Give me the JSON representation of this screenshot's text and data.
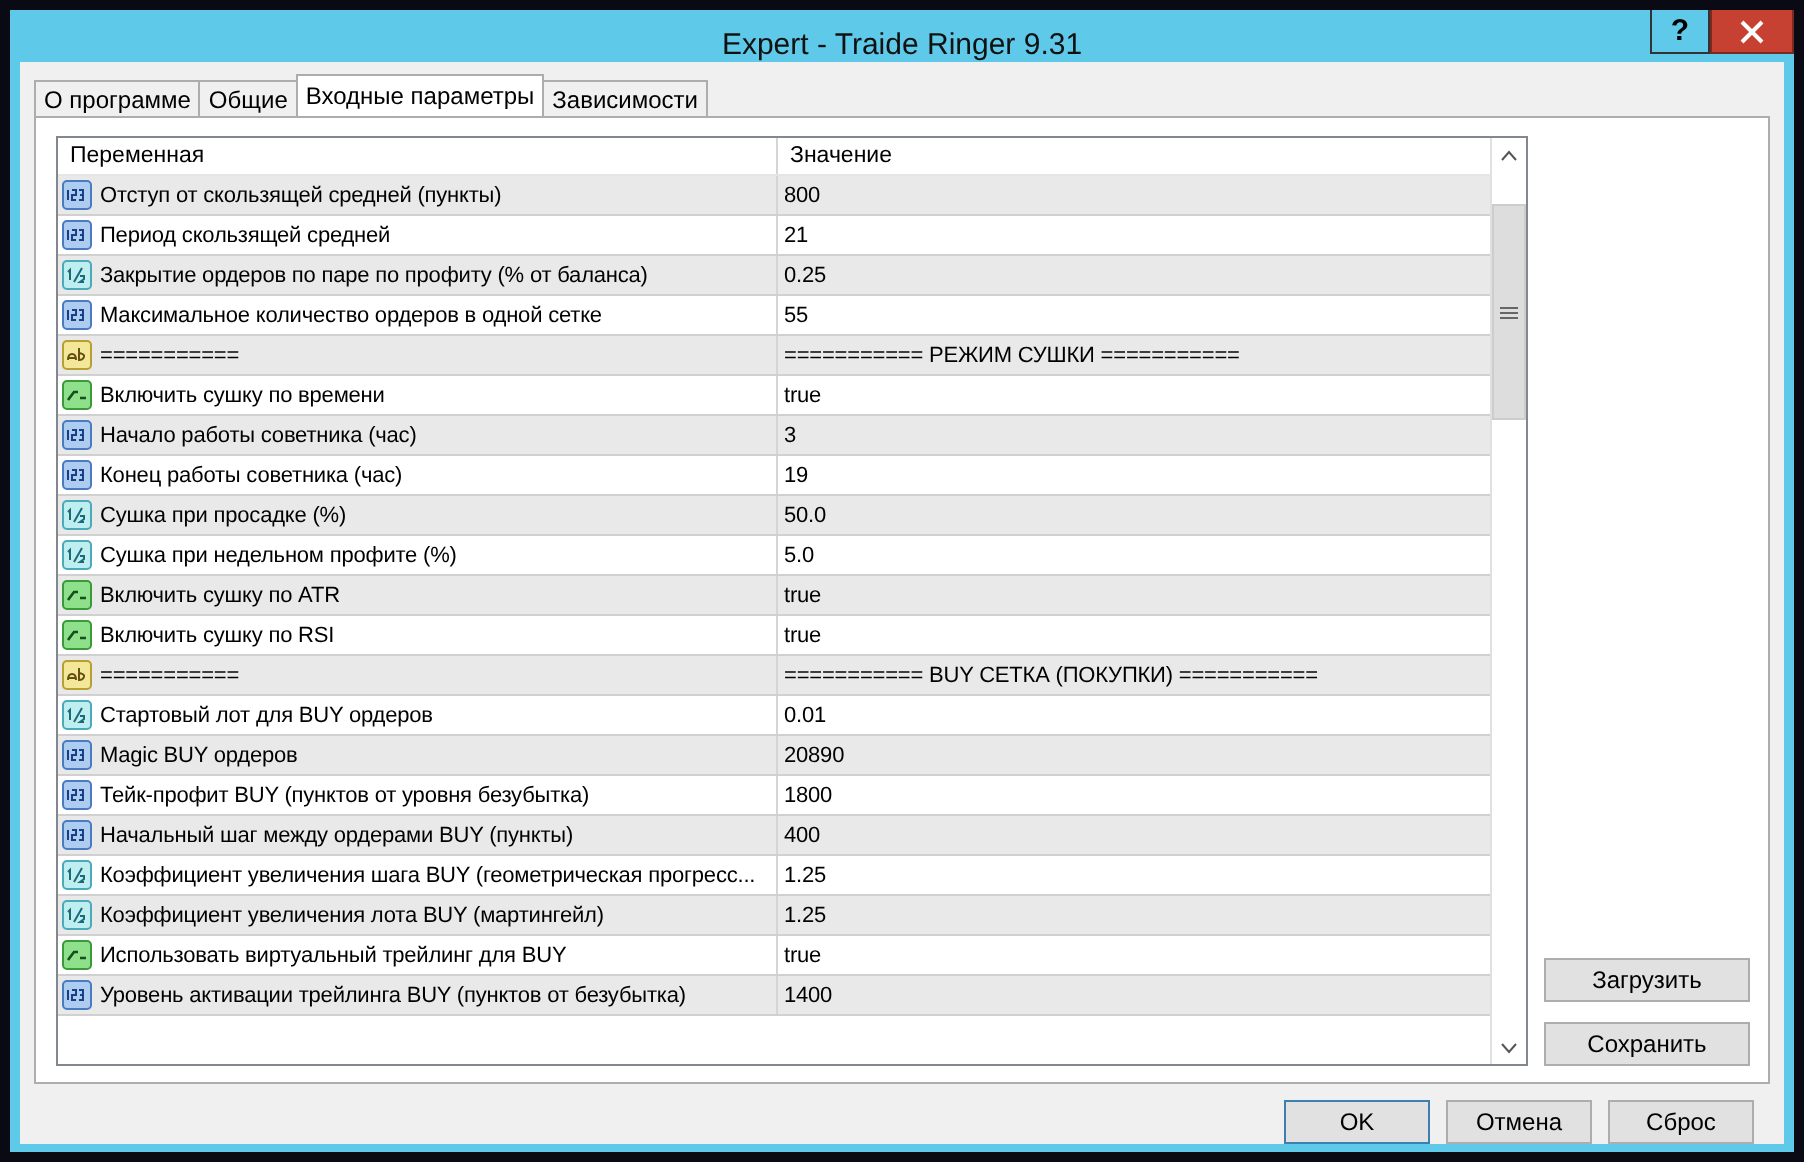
{
  "window": {
    "title": "Expert - Traide Ringer 9.31",
    "help": "?"
  },
  "tabs": [
    {
      "label": "О программе",
      "selected": false
    },
    {
      "label": "Общие",
      "selected": false
    },
    {
      "label": "Входные параметры",
      "selected": true
    },
    {
      "label": "Зависимости",
      "selected": false
    }
  ],
  "table": {
    "columns": [
      "Переменная",
      "Значение"
    ],
    "rows": [
      {
        "kind": "int",
        "name": "Отступ от скользящей средней (пункты)",
        "value": "800"
      },
      {
        "kind": "int",
        "name": "Период скользящей средней",
        "value": "21"
      },
      {
        "kind": "double",
        "name": "Закрытие ордеров по паре по профиту (% от баланса)",
        "value": "0.25"
      },
      {
        "kind": "int",
        "name": "Максимальное количество ордеров в одной сетке",
        "value": "55"
      },
      {
        "kind": "string",
        "name": "===========",
        "value": "=========== РЕЖИМ СУШКИ ==========="
      },
      {
        "kind": "bool",
        "name": "Включить сушку по времени",
        "value": "true"
      },
      {
        "kind": "int",
        "name": "Начало работы советника (час)",
        "value": "3"
      },
      {
        "kind": "int",
        "name": "Конец работы советника (час)",
        "value": "19"
      },
      {
        "kind": "double",
        "name": "Сушка при просадке (%)",
        "value": "50.0"
      },
      {
        "kind": "double",
        "name": "Сушка при недельном профите (%)",
        "value": "5.0"
      },
      {
        "kind": "bool",
        "name": "Включить сушку по ATR",
        "value": "true"
      },
      {
        "kind": "bool",
        "name": "Включить сушку по RSI",
        "value": "true"
      },
      {
        "kind": "string",
        "name": "===========",
        "value": "=========== BUY СЕТКА (ПОКУПКИ) ==========="
      },
      {
        "kind": "double",
        "name": "Стартовый лот для BUY ордеров",
        "value": "0.01"
      },
      {
        "kind": "int",
        "name": "Magic BUY ордеров",
        "value": "20890"
      },
      {
        "kind": "int",
        "name": "Тейк-профит BUY (пунктов от уровня безубытка)",
        "value": "1800"
      },
      {
        "kind": "int",
        "name": "Начальный шаг между ордерами BUY (пункты)",
        "value": "400"
      },
      {
        "kind": "double",
        "name": "Коэффициент увеличения шага BUY (геометрическая прогресс...",
        "value": "1.25"
      },
      {
        "kind": "double",
        "name": "Коэффициент увеличения лота BUY (мартингейл)",
        "value": "1.25"
      },
      {
        "kind": "bool",
        "name": "Использовать виртуальный трейлинг для BUY",
        "value": "true"
      },
      {
        "kind": "int",
        "name": "Уровень активации трейлинга BUY (пунктов от безубытка)",
        "value": "1400"
      }
    ]
  },
  "side_buttons": [
    "Загрузить",
    "Сохранить"
  ],
  "buttons": [
    "OK",
    "Отмена",
    "Сброс"
  ]
}
